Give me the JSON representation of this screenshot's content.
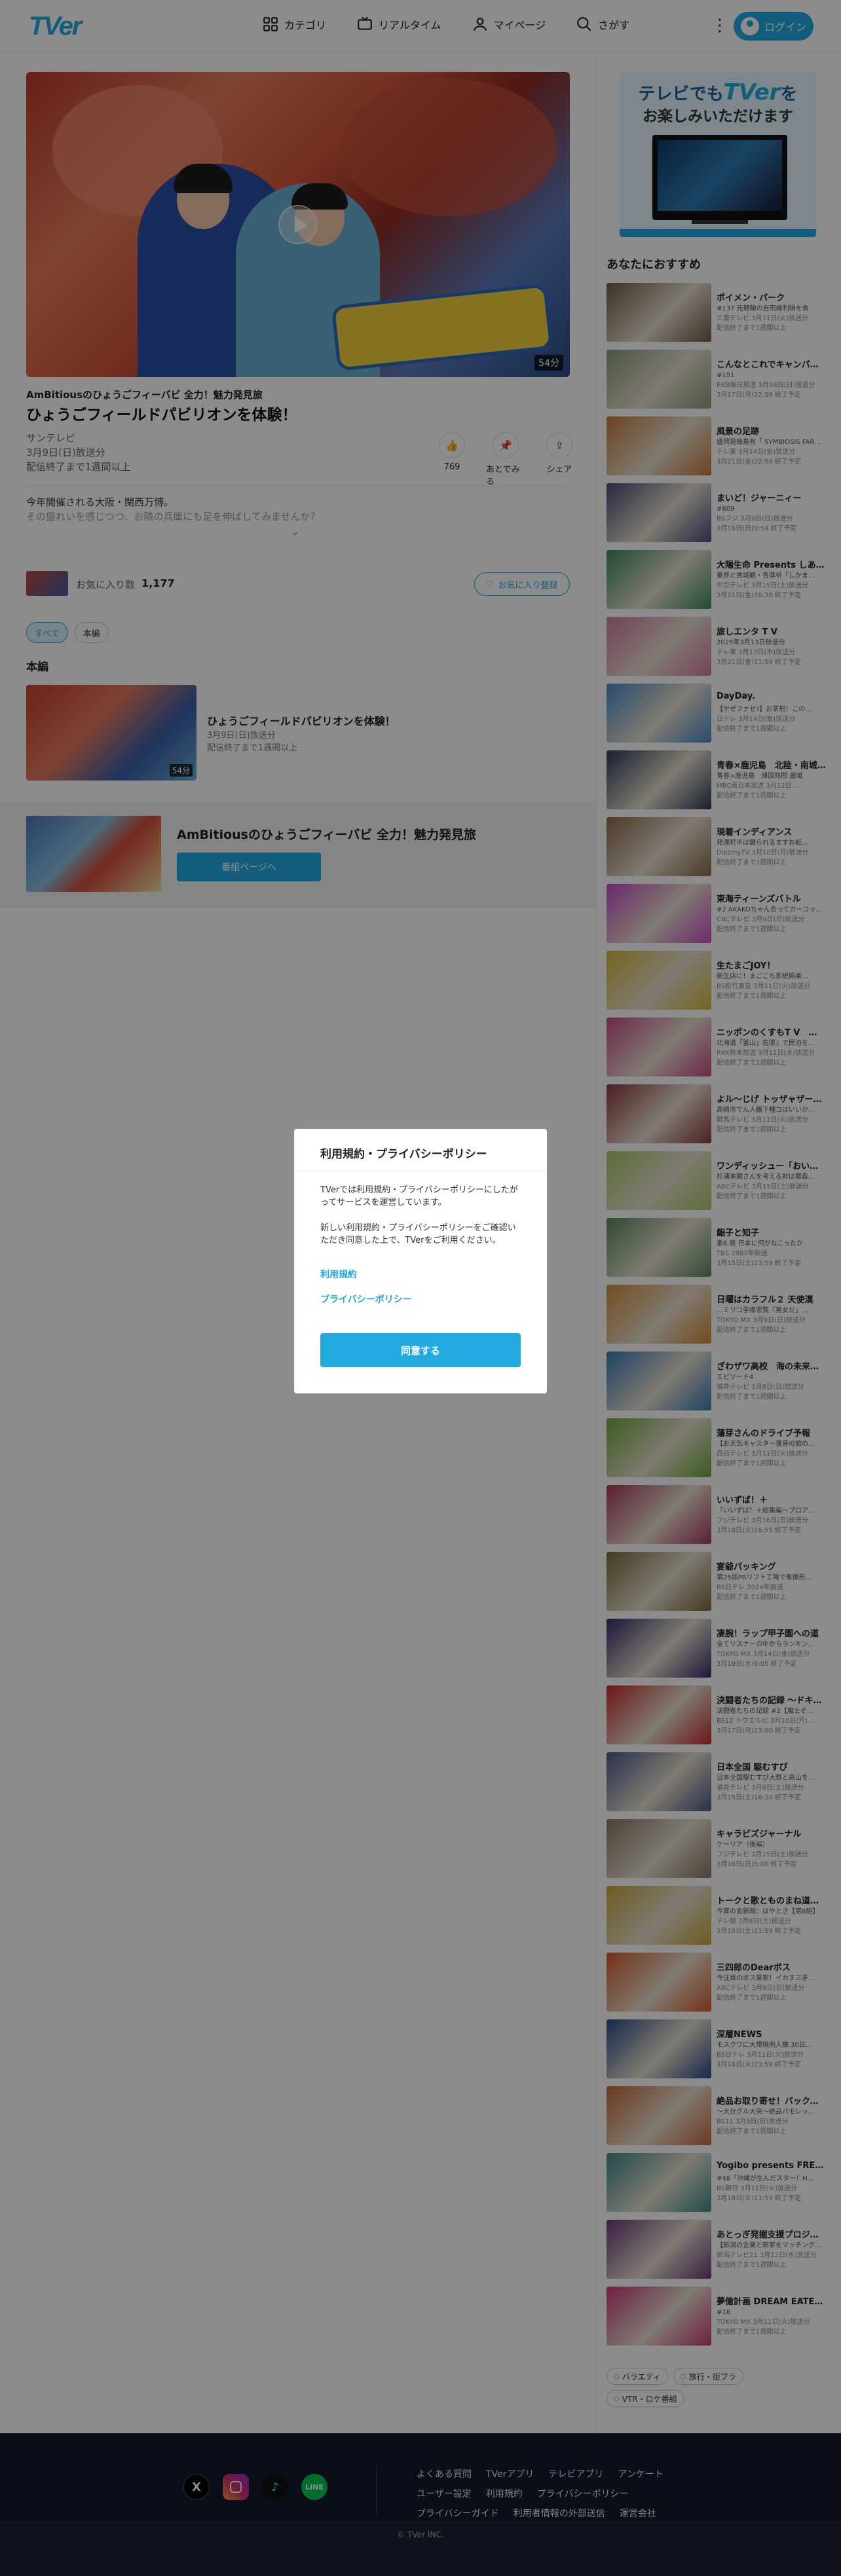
{
  "header": {
    "logo": "TVer",
    "nav": [
      {
        "label": "カテゴリ",
        "icon": "grid-icon"
      },
      {
        "label": "リアルタイム",
        "icon": "tv-icon"
      },
      {
        "label": "マイページ",
        "icon": "person-icon"
      },
      {
        "label": "さがす",
        "icon": "search-icon"
      }
    ],
    "login_label": "ログイン"
  },
  "player": {
    "duration": "54分"
  },
  "episode": {
    "series_title": "AmBitiousのひょうごフィーバビ 全力！魅力発見旅",
    "title": "ひょうごフィールドパビリオンを体験！",
    "broadcaster": "サンテレビ",
    "aired": "3月9日(日)放送分",
    "expires": "配信終了まで1週間以上",
    "actions": [
      {
        "label": "769",
        "icon": "thumbs-up-icon"
      },
      {
        "label": "あとでみる",
        "icon": "pin-icon"
      },
      {
        "label": "シェア",
        "icon": "share-icon"
      }
    ],
    "description": "今年開催される大阪・関西万博。",
    "description_fade": "その盛れいを感じつつ、お隣の兵庫にも足を伸ばしてみませんか？"
  },
  "favorite": {
    "label": "お気に入り数",
    "count": "1,177",
    "button": "お気に入り登録"
  },
  "filter_tabs": [
    "すべて",
    "本編"
  ],
  "section_title": "本編",
  "episode_card": {
    "title": "ひょうごフィールドパビリオンを体験！",
    "aired": "3月9日(日)放送分",
    "expires": "配信終了まで1週間以上",
    "duration": "54分"
  },
  "series_band": {
    "title": "AmBitiousのひょうごフィーバビ 全力！魅力発見旅",
    "button": "番組ページへ"
  },
  "banner": {
    "line1a": "テレビ",
    "line1b": "でも",
    "line1c": "TVer",
    "line1d": "を",
    "line2": "お楽しみいただけます"
  },
  "recommend": {
    "heading": "あなたにおすすめ",
    "items": [
      {
        "title": "ポイメン・パーク",
        "sub": "#137 元競輪の吉田幾利鍋を食",
        "sub2": "三重テレビ 3月11日(火)放送分",
        "sub3": "配信終了まで1週間以上",
        "color": "#6d5a4a"
      },
      {
        "title": "こんなとこれでキャンパー…",
        "sub": "#151",
        "sub2": "RKB毎日放送 3月16日(日)放送分",
        "sub3": "3月17日(月)22:59 終了予定",
        "color": "#8a9c7a"
      },
      {
        "title": "風景の足跡",
        "sub": "盛岡発幾島有「 SYMBIOSIS FAR…",
        "sub2": "テレ東 3月14日(金)放送分",
        "sub3": "3月21日(金)22:59 終了予定",
        "color": "#c87a3a"
      },
      {
        "title": "まいど！ジャーニィー",
        "sub": "#609",
        "sub2": "BSフジ 3月9日(日)放送分",
        "sub3": "3月16日(日)9:54 終了予定",
        "color": "#4a4a7a"
      },
      {
        "title": "大陽生命 Presents しあ…",
        "sub": "業界と貴城観・各厚析「しかま…",
        "sub2": "中京テレビ 3月15日(土)放送分",
        "sub3": "3月21日(金)16:30 終了予定",
        "color": "#3a8a5a"
      },
      {
        "title": "旅しエンタ T V",
        "sub": "2025年3月13日放送分",
        "sub2": "テレ東 3月13日(木)放送分",
        "sub3": "3月21日(金)11:59 終了予定",
        "color": "#d47aa0"
      },
      {
        "title": "DayDay.",
        "sub": "【ヤゼファセ?】お茶刑！この…",
        "sub2": "日テレ 3月14日(金)放送分",
        "sub3": "配信終了まで1週間以上",
        "color": "#4a8ac8"
      },
      {
        "title": "青春×鹿児島　北陸・南城…",
        "sub": "青春×鹿児島　帰国熱問 最暖",
        "sub2": "MBC南日本放送 3月12日…",
        "sub3": "配信終了まで1週間以上",
        "color": "#2a3a5a"
      },
      {
        "title": "現着インディアンス",
        "sub": "発達町半は鍵られるますお紙…",
        "sub2": "DaizmyTV 3月10日(月)放送分",
        "sub3": "配信終了まで1週間以上",
        "color": "#8a6a4a"
      },
      {
        "title": "東海ティーンズバトル",
        "sub": "#2 AKAKOちゃん合ってガーコッオーイ…",
        "sub2": "CBCテレビ 3月9日(日)放送分",
        "sub3": "配信終了まで1週間以上",
        "color": "#c84ac8"
      },
      {
        "title": "生たまごJOY！",
        "sub": "新生店に！まごこち系統照楽…",
        "sub2": "BS松竹東急 3月11日(火)放送分",
        "sub3": "配信終了まで1週間以上",
        "color": "#d4b83a"
      },
      {
        "title": "ニッポンのくすもT V　…",
        "sub": "北海道「釜山」佐原」で民泊を…",
        "sub2": "RKK熊本放送 3月12日(水)放送分",
        "sub3": "配信終了まで1週間以上",
        "color": "#c84a8a"
      },
      {
        "title": "よル～じげ トッザャザーレ…",
        "sub": "高崎市でん人鶴下種コはいいか…",
        "sub2": "群馬テレビ 3月11日(火)放送分",
        "sub3": "配信終了まで1週間以上",
        "color": "#8a3a3a"
      },
      {
        "title": "ワンディッシュー「おいし…",
        "sub": "杉浦未開さんを考える対は羅森…",
        "sub2": "ABCテレビ 3月15日(土)放送分",
        "sub3": "配信終了まで1週間以上",
        "color": "#a8c86a"
      },
      {
        "title": "鮨子と知子",
        "sub": "素6 居 日本に何がなこったか",
        "sub2": "TBS 1987年放送",
        "sub3": "3月15日(土)23:59 終了予定",
        "color": "#5a8a5a"
      },
      {
        "title": "日曜はカラフル２ 天使漠",
        "sub": "…ミリコ学偉思覧「男女だ」…",
        "sub2": "TOKYO MX 3月9日(日)放送分",
        "sub3": "配信終了まで1週間以上",
        "color": "#d48a3a"
      },
      {
        "title": "ざわザワ高校　海の未来を…",
        "sub": "エピソード4",
        "sub2": "福井テレビ 3月9日(日)放送分",
        "sub3": "配信終了まで1週間以上",
        "color": "#3a7ab8"
      },
      {
        "title": "藩芽さんのドライブ予報",
        "sub": "【お天気キャスター藩芽の旅の…",
        "sub2": "西日テレビ 3月11日(火)放送分",
        "sub3": "配信終了まで1週間以上",
        "color": "#6aa83a"
      },
      {
        "title": "いいずば！＋",
        "sub": "「いいずば！＋総集編～ブロア…",
        "sub2": "フジテレビ 3月16日(日)放送分",
        "sub3": "3月18日(火)16:55 終了予定",
        "color": "#a83a5a"
      },
      {
        "title": "宴爺パッキング",
        "sub": "第25話PRリフト工場で象徴形…",
        "sub2": "BS日テレ 2024年放送",
        "sub3": "配信終了まで1週間以上",
        "color": "#7a6a3a"
      },
      {
        "title": "凄腕！ラップ甲子園への道",
        "sub": "全てリスナーの中からランキン…",
        "sub2": "TOKYO MX 3月14日(金)放送分",
        "sub3": "3月19日(水)6:05 終了予定",
        "color": "#3a2a6a"
      },
      {
        "title": "決闘者たちの記録 ～ドキュ…",
        "sub": "決闘者たちの記録 #2【魔土ぞ…",
        "sub2": "BS12 トウエルビ 3月10日(月)…",
        "sub3": "3月17日(月)23:00 終了予定",
        "color": "#c82a2a"
      },
      {
        "title": "日本全国 駆むすび",
        "sub": "日本全国駆むすび大祭と高山を…",
        "sub2": "福井テレビ 3月9日(土)放送分",
        "sub3": "3月15日(土)16:30 終了予定",
        "color": "#4a5a8a"
      },
      {
        "title": "キャラビズジャーナル",
        "sub": "ケーリア（後編）",
        "sub2": "フジテレビ 3月15日(土)放送分",
        "sub3": "3月16日(日)6:00 終了予定",
        "color": "#8a7a6a"
      },
      {
        "title": "トークと歌とものまね道場…",
        "sub": "今宵の会新報：はやとさ【第6組】",
        "sub2": "テレ朝 3月8日(土)放送分",
        "sub3": "3月15日(土)11:59 終了予定",
        "color": "#c8a83a"
      },
      {
        "title": "三四郎のDearボス",
        "sub": "今注目のボス業家！イカす三矛…",
        "sub2": "ABCテレビ 3月9日(日)放送分",
        "sub3": "配信終了まで1週間以上",
        "color": "#d45a2a"
      },
      {
        "title": "深層NEWS",
        "sub": "モスクワに大規模例人機 30日…",
        "sub2": "BS日テレ 3月11日(火)放送分",
        "sub3": "3月18日(火)23:59 終了予定",
        "color": "#2a4a8a"
      },
      {
        "title": "絶品お取り寄せ！バックス…",
        "sub": "～大分グル大突～絶品パモレッ…",
        "sub2": "BS11 3月9日(日)放送分",
        "sub3": "配信終了まで1週間以上",
        "color": "#c86a3a"
      },
      {
        "title": "Yogibo presents FREE…",
        "sub": "#48「沖縄が生んだスター！H…",
        "sub2": "BS朝日 3月11日(火)放送分",
        "sub3": "3月18日(火)11:59 終了予定",
        "color": "#3a8a8a"
      },
      {
        "title": "あとっぎ発掘支援プロジェ…",
        "sub": "【新潟の企業と新家をマッチング…",
        "sub2": "新潟テレビ21 3月12日(水)放送分",
        "sub3": "配信終了まで1週間以上",
        "color": "#6a3a7a"
      },
      {
        "title": "夢億計画 DREAM EATER…",
        "sub": "#18",
        "sub2": "TOKYO MX 3月11日(火)放送分",
        "sub3": "配信終了まで1週間以上",
        "color": "#c83a7a"
      }
    ]
  },
  "genres": [
    "バラエティ",
    "旅行・街ブラ",
    "VTR・ロケ番組"
  ],
  "footer": {
    "social": [
      {
        "icon": "x-icon",
        "label": "X"
      },
      {
        "icon": "instagram-icon",
        "label": ""
      },
      {
        "icon": "tiktok-icon",
        "label": "♪"
      },
      {
        "icon": "line-icon",
        "label": "LINE"
      }
    ],
    "links": [
      "よくある質問",
      "TVerアプリ",
      "テレビアプリ",
      "アンケート",
      "ユーザー設定",
      "利用規約",
      "プライバシーポリシー",
      "プライバシーガイド",
      "利用者情報の外部送信",
      "運営会社"
    ],
    "copyright": "© TVer INC."
  },
  "modal": {
    "title": "利用規約・プライバシーポリシー",
    "body1": "TVerでは利用規約・プライバシーポリシーにしたがってサービスを運営しています。",
    "body2": "新しい利用規約・プライバシーポリシーをご確認いただき同意した上で、TVerをご利用ください。",
    "link_terms": "利用規約",
    "link_privacy": "プライバシーポリシー",
    "agree": "同意する"
  }
}
